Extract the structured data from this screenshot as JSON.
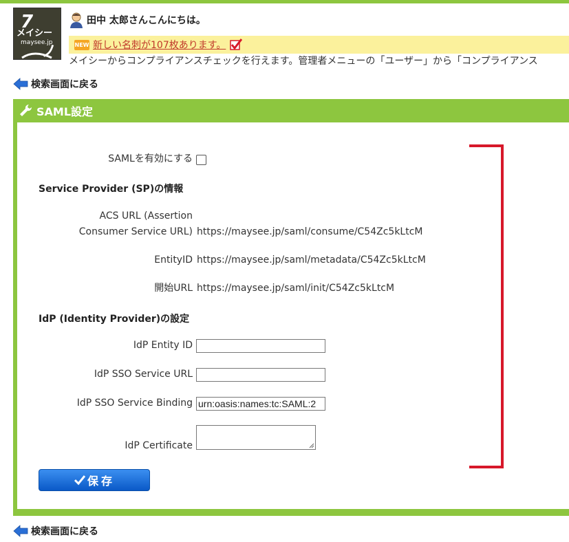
{
  "header": {
    "logo_text": "メイシー maysee.jp",
    "greeting": "田中 太郎さんこんにちは。",
    "notice_badge": "NEW",
    "notice_link": "新しい名刺が107枚あります。",
    "description": "メイシーからコンプライアンスチェックを行えます。管理者メニューの「ユーザー」から「コンプライアンス"
  },
  "nav": {
    "back_top": "検索画面に戻る",
    "back_bottom": "検索画面に戻る"
  },
  "panel": {
    "title": "SAML設定",
    "enable_label": "SAMLを有効にする",
    "sp_section": "Service Provider (SP)の情報",
    "acs_label_line1": "ACS URL (Assertion",
    "acs_label_line2": "Consumer Service URL)",
    "acs_value": "https://maysee.jp/saml/consume/C54Zc5kLtcM",
    "entity_label": "EntityID",
    "entity_value": "https://maysee.jp/saml/metadata/C54Zc5kLtcM",
    "start_label": "開始URL",
    "start_value": "https://maysee.jp/saml/init/C54Zc5kLtcM",
    "idp_section": "IdP (Identity Provider)の設定",
    "idp_entity_label": "IdP Entity ID",
    "idp_entity_value": "",
    "idp_sso_url_label": "IdP SSO Service URL",
    "idp_sso_url_value": "",
    "idp_binding_label": "IdP SSO Service Binding",
    "idp_binding_value": "urn:oasis:names:tc:SAML:2",
    "idp_cert_label": "IdP Certificate",
    "save_label": "保存"
  },
  "colors": {
    "accent_green": "#8dc63f",
    "notice_bg": "#fbf19c",
    "button_blue": "#0a59c7",
    "bracket_red": "#d7182a"
  }
}
